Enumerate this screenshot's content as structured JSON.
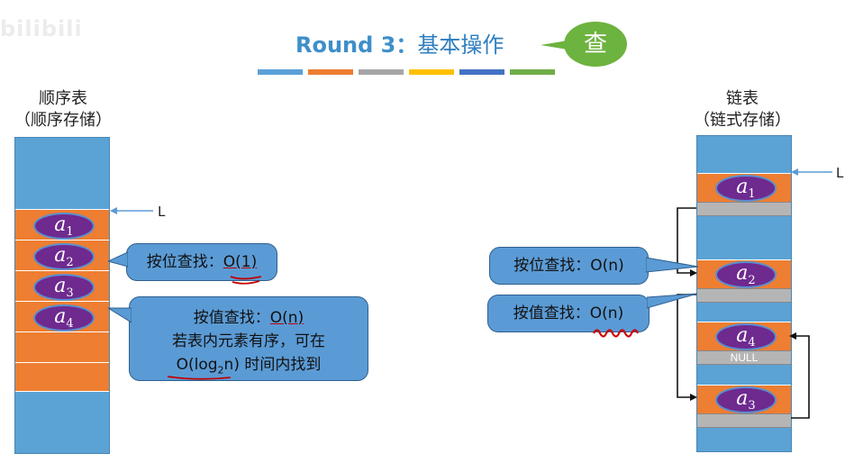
{
  "watermark": "bilibili",
  "title": {
    "en": "Round 3：",
    "zh": "基本操作"
  },
  "tag": "查",
  "colors": [
    "#5aa0d8",
    "#ed7d31",
    "#a5a5a5",
    "#ffc000",
    "#4472c4",
    "#70ad47"
  ],
  "left": {
    "title_line1": "顺序表",
    "title_line2": "（顺序存储）",
    "pointer": "L",
    "elements": [
      {
        "letter": "a",
        "sub": "1"
      },
      {
        "letter": "a",
        "sub": "2"
      },
      {
        "letter": "a",
        "sub": "3"
      },
      {
        "letter": "a",
        "sub": "4"
      }
    ],
    "callout_pos": {
      "label": "按位查找：",
      "complexity": "O(1)"
    },
    "callout_val": {
      "label": "按值查找：",
      "complexity": "O(n)",
      "line2": "若表内元素有序，可在",
      "line3_prefix": "O(log",
      "line3_sub": "2",
      "line3_suffix": "n)",
      "line3_rest": " 时间内找到"
    }
  },
  "right": {
    "title_line1": "链表",
    "title_line2": "（链式存储）",
    "pointer": "L",
    "null_text": "NULL",
    "elements": [
      {
        "letter": "a",
        "sub": "1"
      },
      {
        "letter": "a",
        "sub": "2"
      },
      {
        "letter": "a",
        "sub": "4"
      },
      {
        "letter": "a",
        "sub": "3"
      }
    ],
    "callout_pos": {
      "label": "按位查找：",
      "complexity": "O(n)"
    },
    "callout_val": {
      "label": "按值查找：",
      "complexity": "O(n)"
    }
  }
}
